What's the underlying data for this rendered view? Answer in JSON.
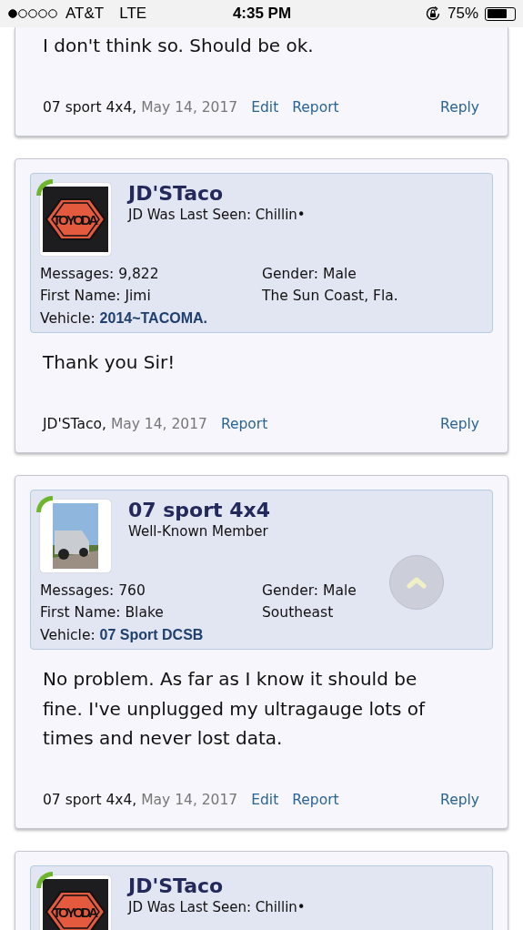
{
  "status_bar": {
    "carrier": "AT&T",
    "network": "LTE",
    "time": "4:35 PM",
    "battery": "75%"
  },
  "posts": [
    {
      "kind": "partial",
      "message": "I don't think so. Should be ok.",
      "footer": {
        "author": "07 sport 4x4,",
        "date": "May 14, 2017",
        "actions": [
          "Edit",
          "Report"
        ],
        "reply": "Reply"
      }
    },
    {
      "kind": "full",
      "user": {
        "name": "JD'STaco",
        "title": "JD Was Last Seen: Chillin•",
        "online": true,
        "avatar": {
          "kind": "logo",
          "text": "TOYODA"
        },
        "left": [
          {
            "label": "Messages:",
            "value": "9,822",
            "link": false
          },
          {
            "label": "First Name:",
            "value": "Jimi",
            "link": false
          },
          {
            "label": "Vehicle:",
            "value": "2014~TACOMA.",
            "link": true
          }
        ],
        "right": [
          {
            "label": "Gender:",
            "value": "Male"
          },
          {
            "value": "The Sun Coast, Fla."
          }
        ]
      },
      "message": "Thank you Sir!",
      "footer": {
        "author": "JD'STaco,",
        "date": "May 14, 2017",
        "actions": [
          "Report"
        ],
        "reply": "Reply"
      }
    },
    {
      "kind": "full",
      "user": {
        "name": "07 sport 4x4",
        "title": "Well-Known Member",
        "online": true,
        "avatar": {
          "kind": "photo"
        },
        "left": [
          {
            "label": "Messages:",
            "value": "760",
            "link": false
          },
          {
            "label": "First Name:",
            "value": "Blake",
            "link": false
          },
          {
            "label": "Vehicle:",
            "value": "07 Sport DCSB",
            "link": true
          }
        ],
        "right": [
          {
            "label": "Gender:",
            "value": "Male"
          },
          {
            "value": "Southeast"
          }
        ]
      },
      "message": "No problem. As far as I know it should be fine. I've unplugged my ultragauge lots of times and never lost data.",
      "footer": {
        "author": "07 sport 4x4,",
        "date": "May 14, 2017",
        "actions": [
          "Edit",
          "Report"
        ],
        "reply": "Reply"
      }
    },
    {
      "kind": "header",
      "user": {
        "name": "JD'STaco",
        "title": "JD Was Last Seen: Chillin•",
        "online": true,
        "avatar": {
          "kind": "logo",
          "text": "TOYODA"
        }
      }
    }
  ],
  "scroll_top_button": {
    "visible": true
  }
}
